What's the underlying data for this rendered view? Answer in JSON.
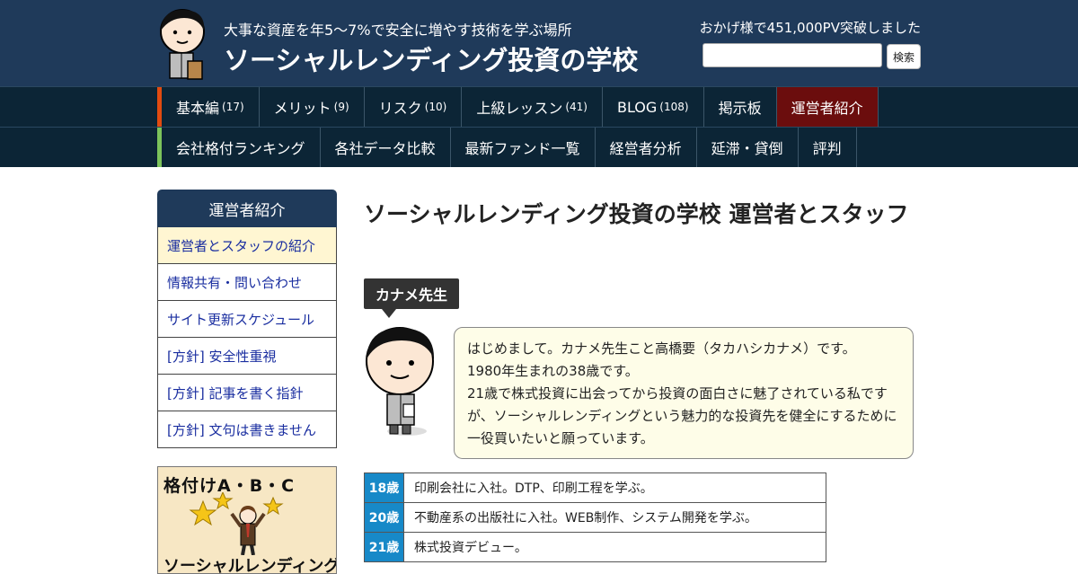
{
  "header": {
    "tagline": "大事な資産を年5～7%で安全に増やす技術を学ぶ場所",
    "site_title": "ソーシャルレンディング投資の学校",
    "pv_text": "おかげ様で451,000PV突破しました",
    "search_placeholder": "",
    "search_button": "検索"
  },
  "nav_primary": [
    {
      "label": "基本編",
      "count": "(17)"
    },
    {
      "label": "メリット",
      "count": "(9)"
    },
    {
      "label": "リスク",
      "count": "(10)"
    },
    {
      "label": "上級レッスン",
      "count": "(41)"
    },
    {
      "label": "BLOG",
      "count": "(108)"
    },
    {
      "label": "掲示板",
      "count": ""
    },
    {
      "label": "運営者紹介",
      "count": ""
    }
  ],
  "nav_secondary": [
    {
      "label": "会社格付ランキング"
    },
    {
      "label": "各社データ比較"
    },
    {
      "label": "最新ファンド一覧"
    },
    {
      "label": "経営者分析"
    },
    {
      "label": "延滞・貸倒"
    },
    {
      "label": "評判"
    }
  ],
  "sidebar": {
    "title": "運営者紹介",
    "items": [
      {
        "label": "運営者とスタッフの紹介"
      },
      {
        "label": "情報共有・問い合わせ"
      },
      {
        "label": "サイト更新スケジュール"
      },
      {
        "label": "[方針] 安全性重視"
      },
      {
        "label": "[方針] 記事を書く指針"
      },
      {
        "label": "[方針] 文句は書きません"
      }
    ],
    "banner_top": "格付けA・B・C",
    "banner_bottom": "ソーシャルレンディング会社"
  },
  "main": {
    "title": "ソーシャルレンディング投資の学校 運営者とスタッフ",
    "teacher_name": "カナメ先生",
    "intro": [
      "はじめまして。カナメ先生こと高橋要（タカハシカナメ）です。",
      "1980年生まれの38歳です。",
      "21歳で株式投資に出会ってから投資の面白さに魅了されている私ですが、ソーシャルレンディングという魅力的な投資先を健全にするために一役買いたいと願っています。"
    ],
    "history": [
      {
        "age": "18歳",
        "event": "印刷会社に入社。DTP、印刷工程を学ぶ。"
      },
      {
        "age": "20歳",
        "event": "不動産系の出版社に入社。WEB制作、システム開発を学ぶ。"
      },
      {
        "age": "21歳",
        "event": "株式投資デビュー。"
      }
    ]
  },
  "colors": {
    "header_bg": "#1f3a5a",
    "nav_bg": "#0c2536",
    "nav_active": "#6b0d0d",
    "accent_orange": "#e24b10",
    "accent_green": "#7cc35b",
    "age_blue": "#1789c8",
    "speech_bg": "#fefde8",
    "sidebar_active": "#fff6d2"
  }
}
